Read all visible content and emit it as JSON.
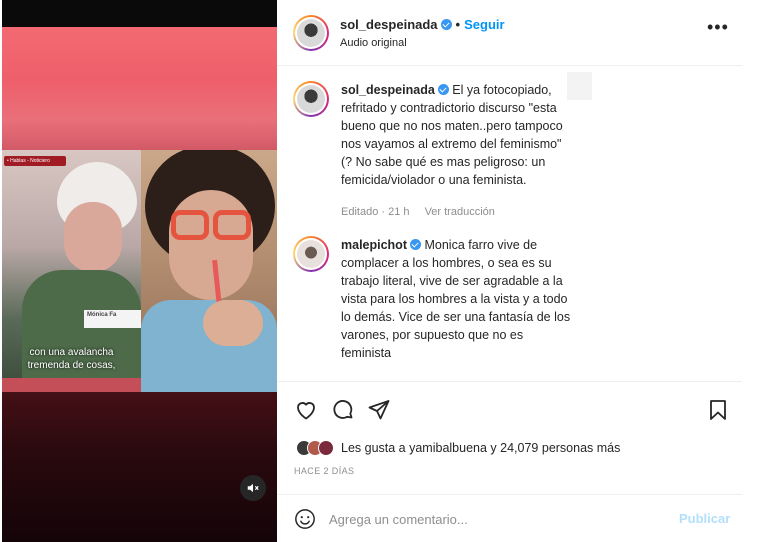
{
  "post": {
    "username": "sol_despeinada",
    "follow_label": "Seguir",
    "separator": "•",
    "audio_label": "Audio original",
    "more_label": "•••"
  },
  "video": {
    "tag_text": "• Hablas - Noticiero",
    "name_text": "Mónica Fa",
    "caption_line1": "con una avalancha",
    "caption_line2": "tremenda de cosas,"
  },
  "comments": [
    {
      "username": "sol_despeinada",
      "text": "El ya fotocopiado, refritado y contradictorio discurso \"esta bueno que no nos maten..pero tampoco nos vayamos al extremo del feminismo\" (? No sabe qué es mas peligroso: un femicida/violador o una feminista.",
      "edited": "Editado · 21 h",
      "translate": "Ver traducción"
    },
    {
      "username": "malepichot",
      "text": "Monica farro vive de complacer a los hombres, o sea es su trabajo literal, vive de ser agradable a la vista para los hombres a la vista y a todo lo demás. Vice de ser una fantasía de los varones, por supuesto que no es feminista"
    }
  ],
  "actions": {
    "likes_prefix": "Les gusta a ",
    "likes_user": "yamibalbuena",
    "likes_middle": " y ",
    "likes_count": "24,079 personas más",
    "time_ago": "HACE 2 DÍAS"
  },
  "add_comment": {
    "placeholder": "Agrega un comentario...",
    "publish_label": "Publicar"
  },
  "colors": {
    "accent": "#0095f6",
    "verified": "#3897f0",
    "publish_disabled": "#b2dffc",
    "muted_text": "#8e8e8e"
  },
  "icons": [
    "heart-icon",
    "comment-icon",
    "share-icon",
    "bookmark-icon",
    "emoji-icon",
    "mute-icon",
    "verified-icon",
    "more-icon"
  ]
}
